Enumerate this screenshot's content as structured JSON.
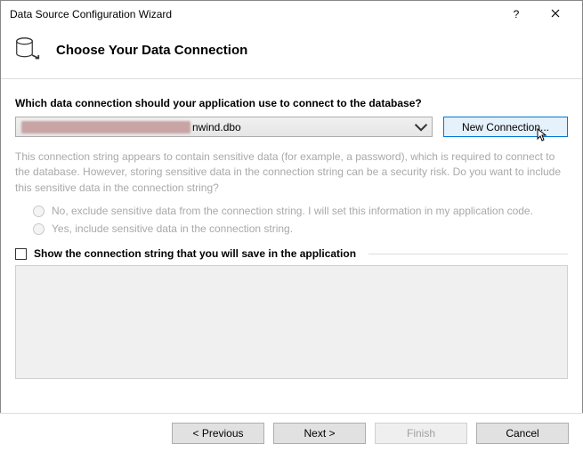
{
  "window": {
    "title": "Data Source Configuration Wizard"
  },
  "header": {
    "heading": "Choose Your Data Connection"
  },
  "prompt": "Which data connection should your application use to connect to the database?",
  "connection": {
    "selected_suffix": "nwind.dbo",
    "new_button": "New Connection..."
  },
  "sensitive_text": "This connection string appears to contain sensitive data (for example, a password), which is required to connect to the database. However, storing sensitive data in the connection string can be a security risk. Do you want to include this sensitive data in the connection string?",
  "radio_no": "No, exclude sensitive data from the connection string. I will set this information in my application code.",
  "radio_yes": "Yes, include sensitive data in the connection string.",
  "show_cs_label": "Show the connection string that you will save in the application",
  "footer": {
    "previous": "< Previous",
    "next": "Next >",
    "finish": "Finish",
    "cancel": "Cancel"
  }
}
